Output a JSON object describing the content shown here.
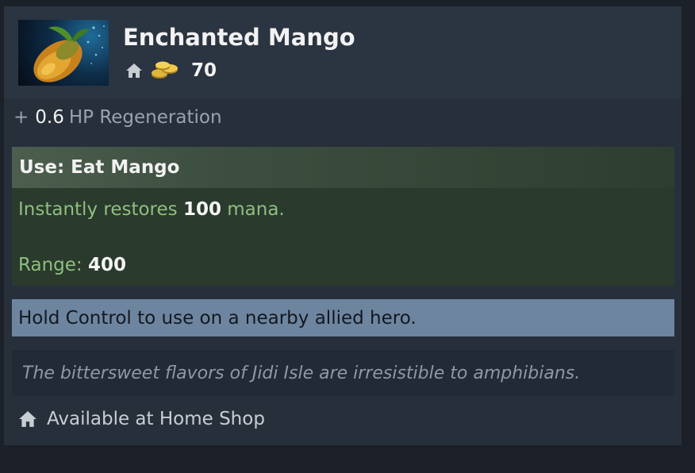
{
  "item": {
    "name": "Enchanted Mango",
    "cost": "70",
    "icon": "mango-icon"
  },
  "stat": {
    "plus": "+",
    "value": "0.6",
    "label": "HP Regeneration"
  },
  "ability": {
    "title": "Use: Eat Mango",
    "desc_prefix": "Instantly restores",
    "desc_value": "100",
    "desc_suffix": "mana.",
    "range_label": "Range:",
    "range_value": "400"
  },
  "hint": "Hold Control to use on a nearby allied hero.",
  "lore": "The bittersweet flavors of Jidi Isle are irresistible to amphibians.",
  "availability": "Available at Home Shop",
  "colors": {
    "background": "#1b2029",
    "panel": "#272f3b",
    "ability_bg": "#2a3a2d",
    "ability_text": "#8fbf7f",
    "hint_bg": "#6e85a0",
    "gold": "#e0b53a"
  }
}
